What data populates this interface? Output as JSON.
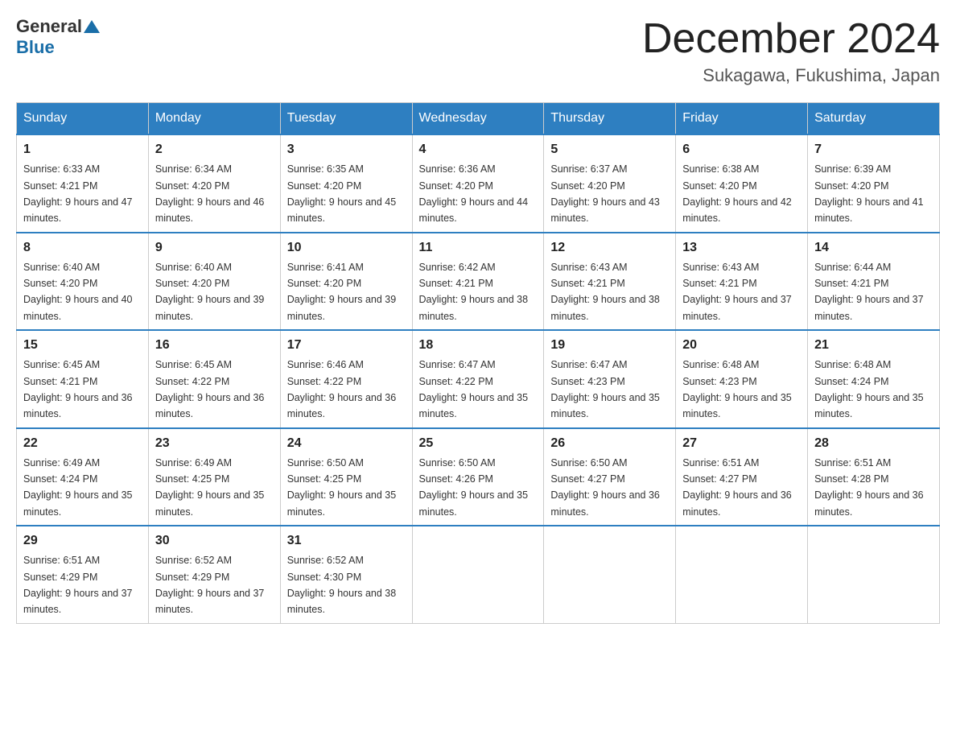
{
  "header": {
    "logo_general": "General",
    "logo_blue": "Blue",
    "month_title": "December 2024",
    "location": "Sukagawa, Fukushima, Japan"
  },
  "weekdays": [
    "Sunday",
    "Monday",
    "Tuesday",
    "Wednesday",
    "Thursday",
    "Friday",
    "Saturday"
  ],
  "weeks": [
    [
      {
        "day": "1",
        "sunrise": "6:33 AM",
        "sunset": "4:21 PM",
        "daylight": "9 hours and 47 minutes."
      },
      {
        "day": "2",
        "sunrise": "6:34 AM",
        "sunset": "4:20 PM",
        "daylight": "9 hours and 46 minutes."
      },
      {
        "day": "3",
        "sunrise": "6:35 AM",
        "sunset": "4:20 PM",
        "daylight": "9 hours and 45 minutes."
      },
      {
        "day": "4",
        "sunrise": "6:36 AM",
        "sunset": "4:20 PM",
        "daylight": "9 hours and 44 minutes."
      },
      {
        "day": "5",
        "sunrise": "6:37 AM",
        "sunset": "4:20 PM",
        "daylight": "9 hours and 43 minutes."
      },
      {
        "day": "6",
        "sunrise": "6:38 AM",
        "sunset": "4:20 PM",
        "daylight": "9 hours and 42 minutes."
      },
      {
        "day": "7",
        "sunrise": "6:39 AM",
        "sunset": "4:20 PM",
        "daylight": "9 hours and 41 minutes."
      }
    ],
    [
      {
        "day": "8",
        "sunrise": "6:40 AM",
        "sunset": "4:20 PM",
        "daylight": "9 hours and 40 minutes."
      },
      {
        "day": "9",
        "sunrise": "6:40 AM",
        "sunset": "4:20 PM",
        "daylight": "9 hours and 39 minutes."
      },
      {
        "day": "10",
        "sunrise": "6:41 AM",
        "sunset": "4:20 PM",
        "daylight": "9 hours and 39 minutes."
      },
      {
        "day": "11",
        "sunrise": "6:42 AM",
        "sunset": "4:21 PM",
        "daylight": "9 hours and 38 minutes."
      },
      {
        "day": "12",
        "sunrise": "6:43 AM",
        "sunset": "4:21 PM",
        "daylight": "9 hours and 38 minutes."
      },
      {
        "day": "13",
        "sunrise": "6:43 AM",
        "sunset": "4:21 PM",
        "daylight": "9 hours and 37 minutes."
      },
      {
        "day": "14",
        "sunrise": "6:44 AM",
        "sunset": "4:21 PM",
        "daylight": "9 hours and 37 minutes."
      }
    ],
    [
      {
        "day": "15",
        "sunrise": "6:45 AM",
        "sunset": "4:21 PM",
        "daylight": "9 hours and 36 minutes."
      },
      {
        "day": "16",
        "sunrise": "6:45 AM",
        "sunset": "4:22 PM",
        "daylight": "9 hours and 36 minutes."
      },
      {
        "day": "17",
        "sunrise": "6:46 AM",
        "sunset": "4:22 PM",
        "daylight": "9 hours and 36 minutes."
      },
      {
        "day": "18",
        "sunrise": "6:47 AM",
        "sunset": "4:22 PM",
        "daylight": "9 hours and 35 minutes."
      },
      {
        "day": "19",
        "sunrise": "6:47 AM",
        "sunset": "4:23 PM",
        "daylight": "9 hours and 35 minutes."
      },
      {
        "day": "20",
        "sunrise": "6:48 AM",
        "sunset": "4:23 PM",
        "daylight": "9 hours and 35 minutes."
      },
      {
        "day": "21",
        "sunrise": "6:48 AM",
        "sunset": "4:24 PM",
        "daylight": "9 hours and 35 minutes."
      }
    ],
    [
      {
        "day": "22",
        "sunrise": "6:49 AM",
        "sunset": "4:24 PM",
        "daylight": "9 hours and 35 minutes."
      },
      {
        "day": "23",
        "sunrise": "6:49 AM",
        "sunset": "4:25 PM",
        "daylight": "9 hours and 35 minutes."
      },
      {
        "day": "24",
        "sunrise": "6:50 AM",
        "sunset": "4:25 PM",
        "daylight": "9 hours and 35 minutes."
      },
      {
        "day": "25",
        "sunrise": "6:50 AM",
        "sunset": "4:26 PM",
        "daylight": "9 hours and 35 minutes."
      },
      {
        "day": "26",
        "sunrise": "6:50 AM",
        "sunset": "4:27 PM",
        "daylight": "9 hours and 36 minutes."
      },
      {
        "day": "27",
        "sunrise": "6:51 AM",
        "sunset": "4:27 PM",
        "daylight": "9 hours and 36 minutes."
      },
      {
        "day": "28",
        "sunrise": "6:51 AM",
        "sunset": "4:28 PM",
        "daylight": "9 hours and 36 minutes."
      }
    ],
    [
      {
        "day": "29",
        "sunrise": "6:51 AM",
        "sunset": "4:29 PM",
        "daylight": "9 hours and 37 minutes."
      },
      {
        "day": "30",
        "sunrise": "6:52 AM",
        "sunset": "4:29 PM",
        "daylight": "9 hours and 37 minutes."
      },
      {
        "day": "31",
        "sunrise": "6:52 AM",
        "sunset": "4:30 PM",
        "daylight": "9 hours and 38 minutes."
      },
      null,
      null,
      null,
      null
    ]
  ]
}
